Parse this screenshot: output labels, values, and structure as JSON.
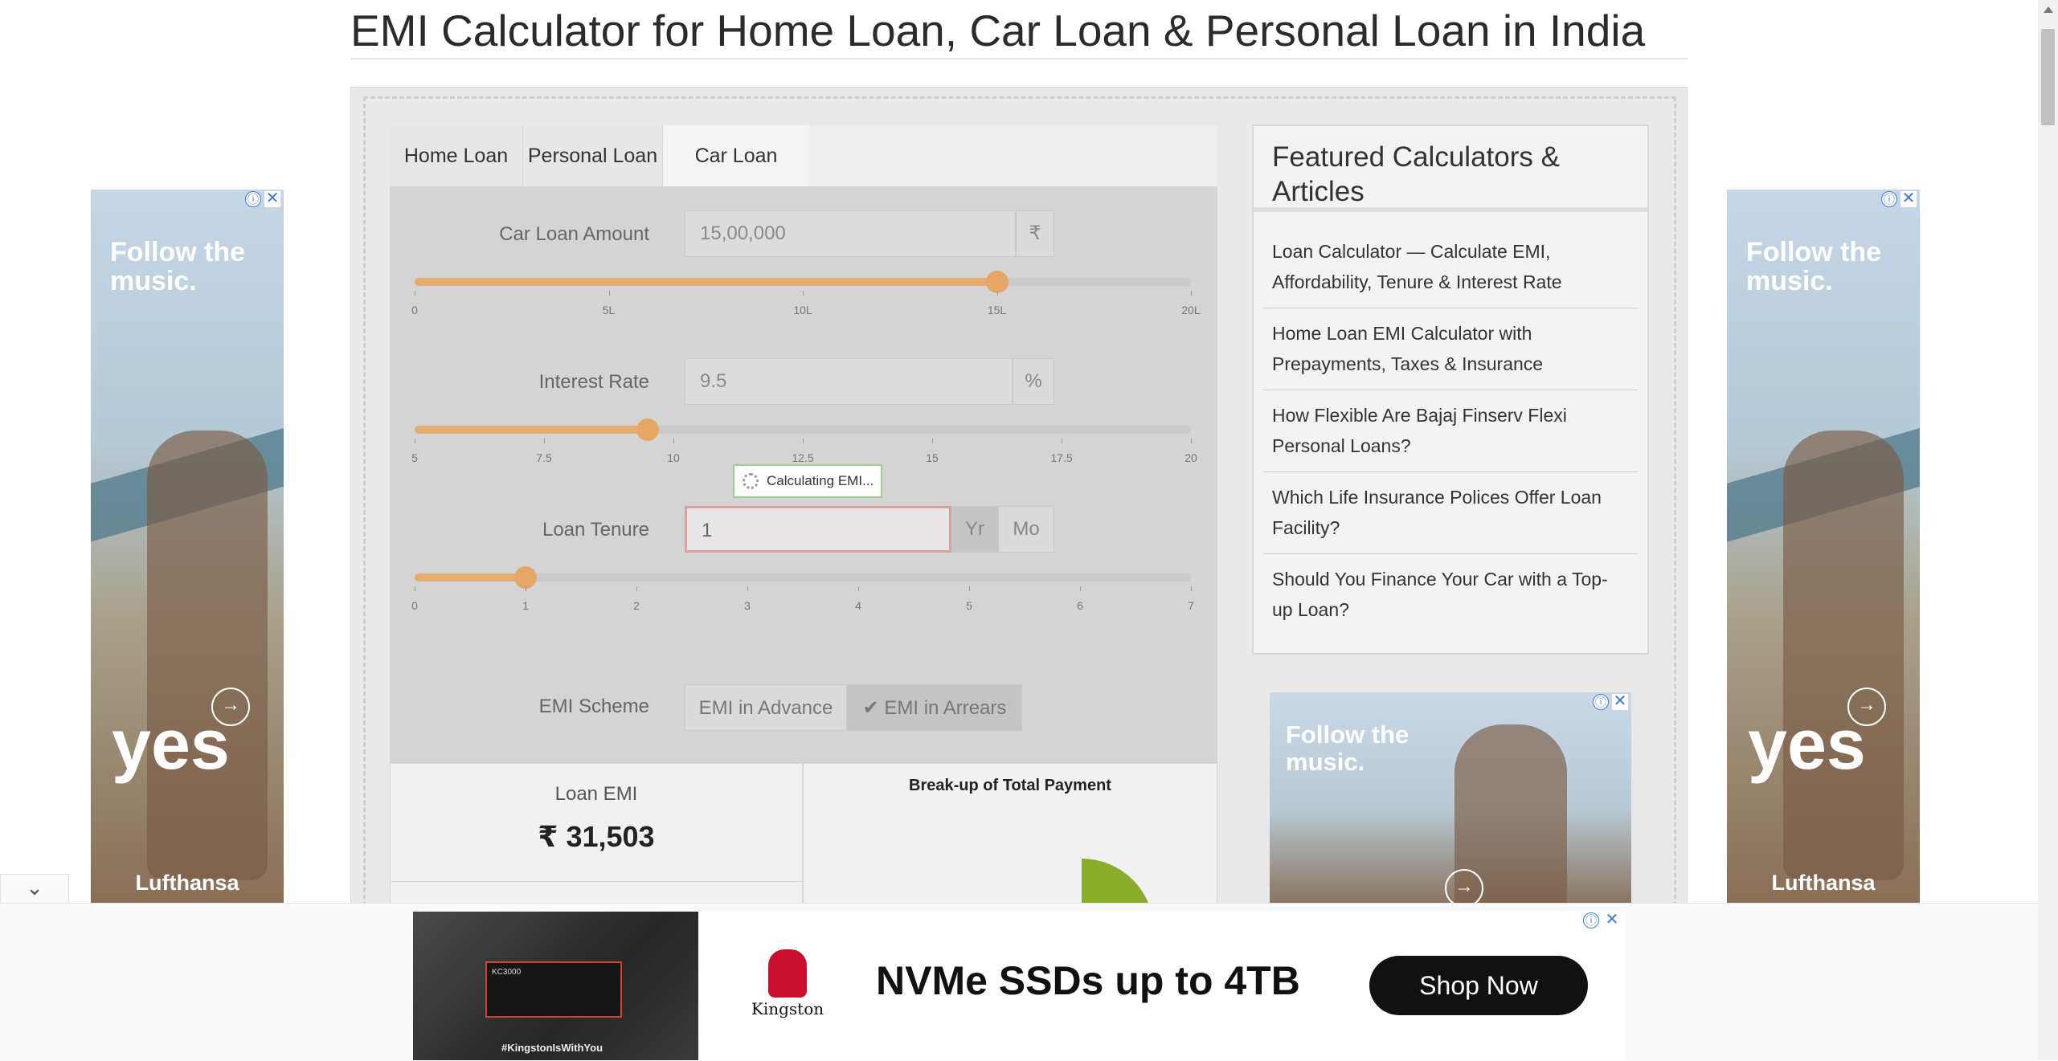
{
  "page": {
    "title": "EMI Calculator for Home Loan, Car Loan & Personal Loan in India"
  },
  "calculator": {
    "tabs": [
      "Home Loan",
      "Personal Loan",
      "Car Loan"
    ],
    "active_tab": "Car Loan",
    "amount": {
      "label": "Car Loan Amount",
      "value": "15,00,000",
      "unit": "₹",
      "slider_value": 1500000,
      "slider_min": 0,
      "slider_max": 2000000,
      "ticks": [
        "0",
        "5L",
        "10L",
        "15L",
        "20L"
      ]
    },
    "interest": {
      "label": "Interest Rate",
      "value": "9.5",
      "unit": "%",
      "slider_value": 9.5,
      "slider_min": 5,
      "slider_max": 20,
      "ticks": [
        "5",
        "7.5",
        "10",
        "12.5",
        "15",
        "17.5",
        "20"
      ]
    },
    "loading_text": "Calculating EMI...",
    "tenure": {
      "label": "Loan Tenure",
      "value": "1",
      "unit_year": "Yr",
      "unit_month": "Mo",
      "selected_unit": "Yr",
      "slider_value": 1,
      "slider_min": 0,
      "slider_max": 7,
      "ticks": [
        "0",
        "1",
        "2",
        "3",
        "4",
        "5",
        "6",
        "7"
      ]
    },
    "scheme": {
      "label": "EMI Scheme",
      "option_advance": "EMI in Advance",
      "option_arrears": "EMI in Arrears",
      "selected": "EMI in Arrears"
    },
    "result": {
      "emi_label": "Loan EMI",
      "emi_value": "₹ 31,503",
      "breakup_title": "Break-up of Total Payment"
    }
  },
  "featured": {
    "title": "Featured Calculators & Articles",
    "items": [
      "Loan Calculator — Calculate EMI, Affordability, Tenure & Interest Rate",
      "Home Loan EMI Calculator with Prepayments, Taxes & Insurance",
      "How Flexible Are Bajaj Finserv Flexi Personal Loans?",
      "Which Life Insurance Polices Offer Loan Facility?",
      "Should You Finance Your Car with a Top-up Loan?"
    ]
  },
  "ads": {
    "side_headline": "Follow the music.",
    "side_yes": "yes",
    "side_brand": "Lufthansa",
    "mid_headline": "Follow the music.",
    "banner_brand": "Kingston",
    "banner_headline": "NVMe SSDs up to 4TB",
    "banner_cta": "Shop Now",
    "banner_tagline": "#KingstonIsWithYou",
    "banner_product": "KC3000",
    "info_icon": "ⓘ",
    "close_icon": "✕"
  },
  "colors": {
    "slider_fill": "#e5ad72",
    "slider_knob": "#e6a766",
    "pie_green": "#8bab2b",
    "focus_border": "#d9a0a0"
  }
}
